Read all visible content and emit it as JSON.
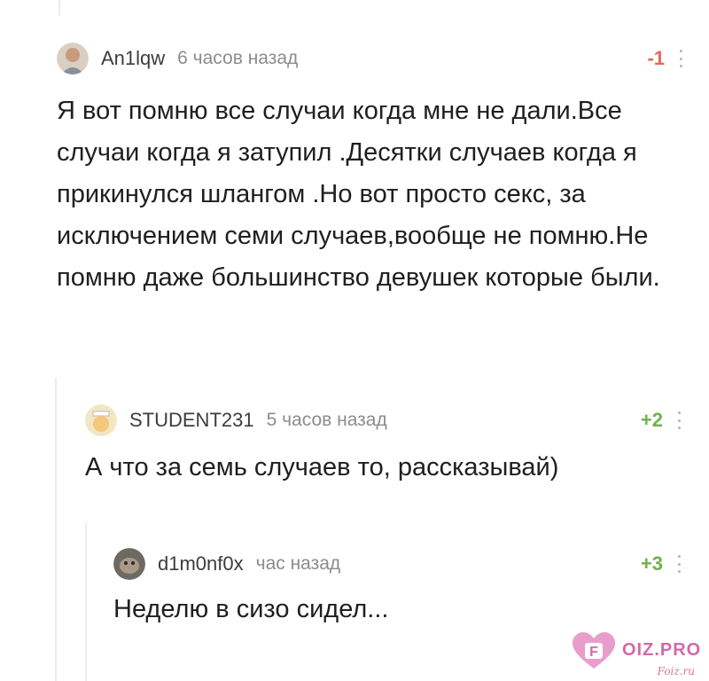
{
  "comments": [
    {
      "author": "An1lqw",
      "time": "6 часов назад",
      "rating": "-1",
      "avatar_icon": "user-photo-avatar-icon",
      "text": "Я вот помню все случаи когда мне не дали.Все случаи когда я затупил .Десятки случаев когда я прикинулся шлангом .Но вот просто секс, за исключением семи случаев,вообще не помню.Не помню даже большинство девушек которые были."
    },
    {
      "author": "STUDENT231",
      "time": "5 часов назад",
      "rating": "+2",
      "avatar_icon": "student-avatar-icon",
      "text": "А что за семь случаев то, рассказывай)"
    },
    {
      "author": "d1m0nf0x",
      "time": "час назад",
      "rating": "+3",
      "avatar_icon": "animal-photo-avatar-icon",
      "text": "Неделю в сизо сидел..."
    }
  ],
  "watermark": {
    "text": "OIZ.PRO",
    "sub": "Foiz.ru",
    "icon": "heart-logo-icon"
  },
  "colors": {
    "negative": "#e26a5a",
    "positive": "#6fb24b",
    "muted": "#8c8c8c",
    "logo": "#d16aa7"
  }
}
